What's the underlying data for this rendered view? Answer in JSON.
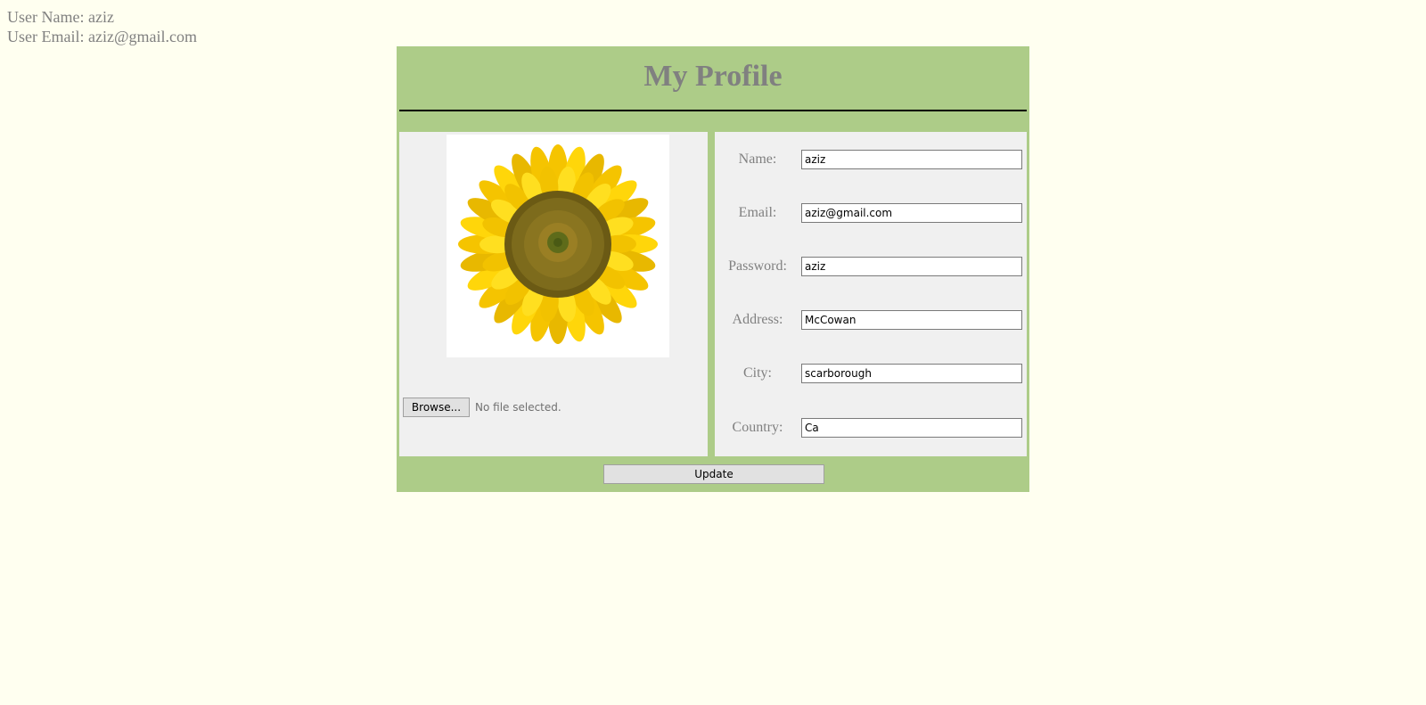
{
  "user_info": {
    "name_label": "User Name:",
    "name_value": "aziz",
    "email_label": "User Email:",
    "email_value": "aziz@gmail.com"
  },
  "profile": {
    "title": "My Profile",
    "avatar_icon": "sunflower-image",
    "browse_label": "Browse...",
    "file_status": "No file selected.",
    "update_label": "Update",
    "fields": [
      {
        "label": "Name:",
        "value": "aziz"
      },
      {
        "label": "Email:",
        "value": "aziz@gmail.com"
      },
      {
        "label": "Password:",
        "value": "aziz"
      },
      {
        "label": "Address:",
        "value": "McCowan"
      },
      {
        "label": "City:",
        "value": "scarborough"
      },
      {
        "label": "Country:",
        "value": "Ca"
      }
    ]
  },
  "colors": {
    "page_background": "#fffff0",
    "panel_background": "#adcc88",
    "box_background": "#f0f0f0",
    "text": "#808080"
  }
}
